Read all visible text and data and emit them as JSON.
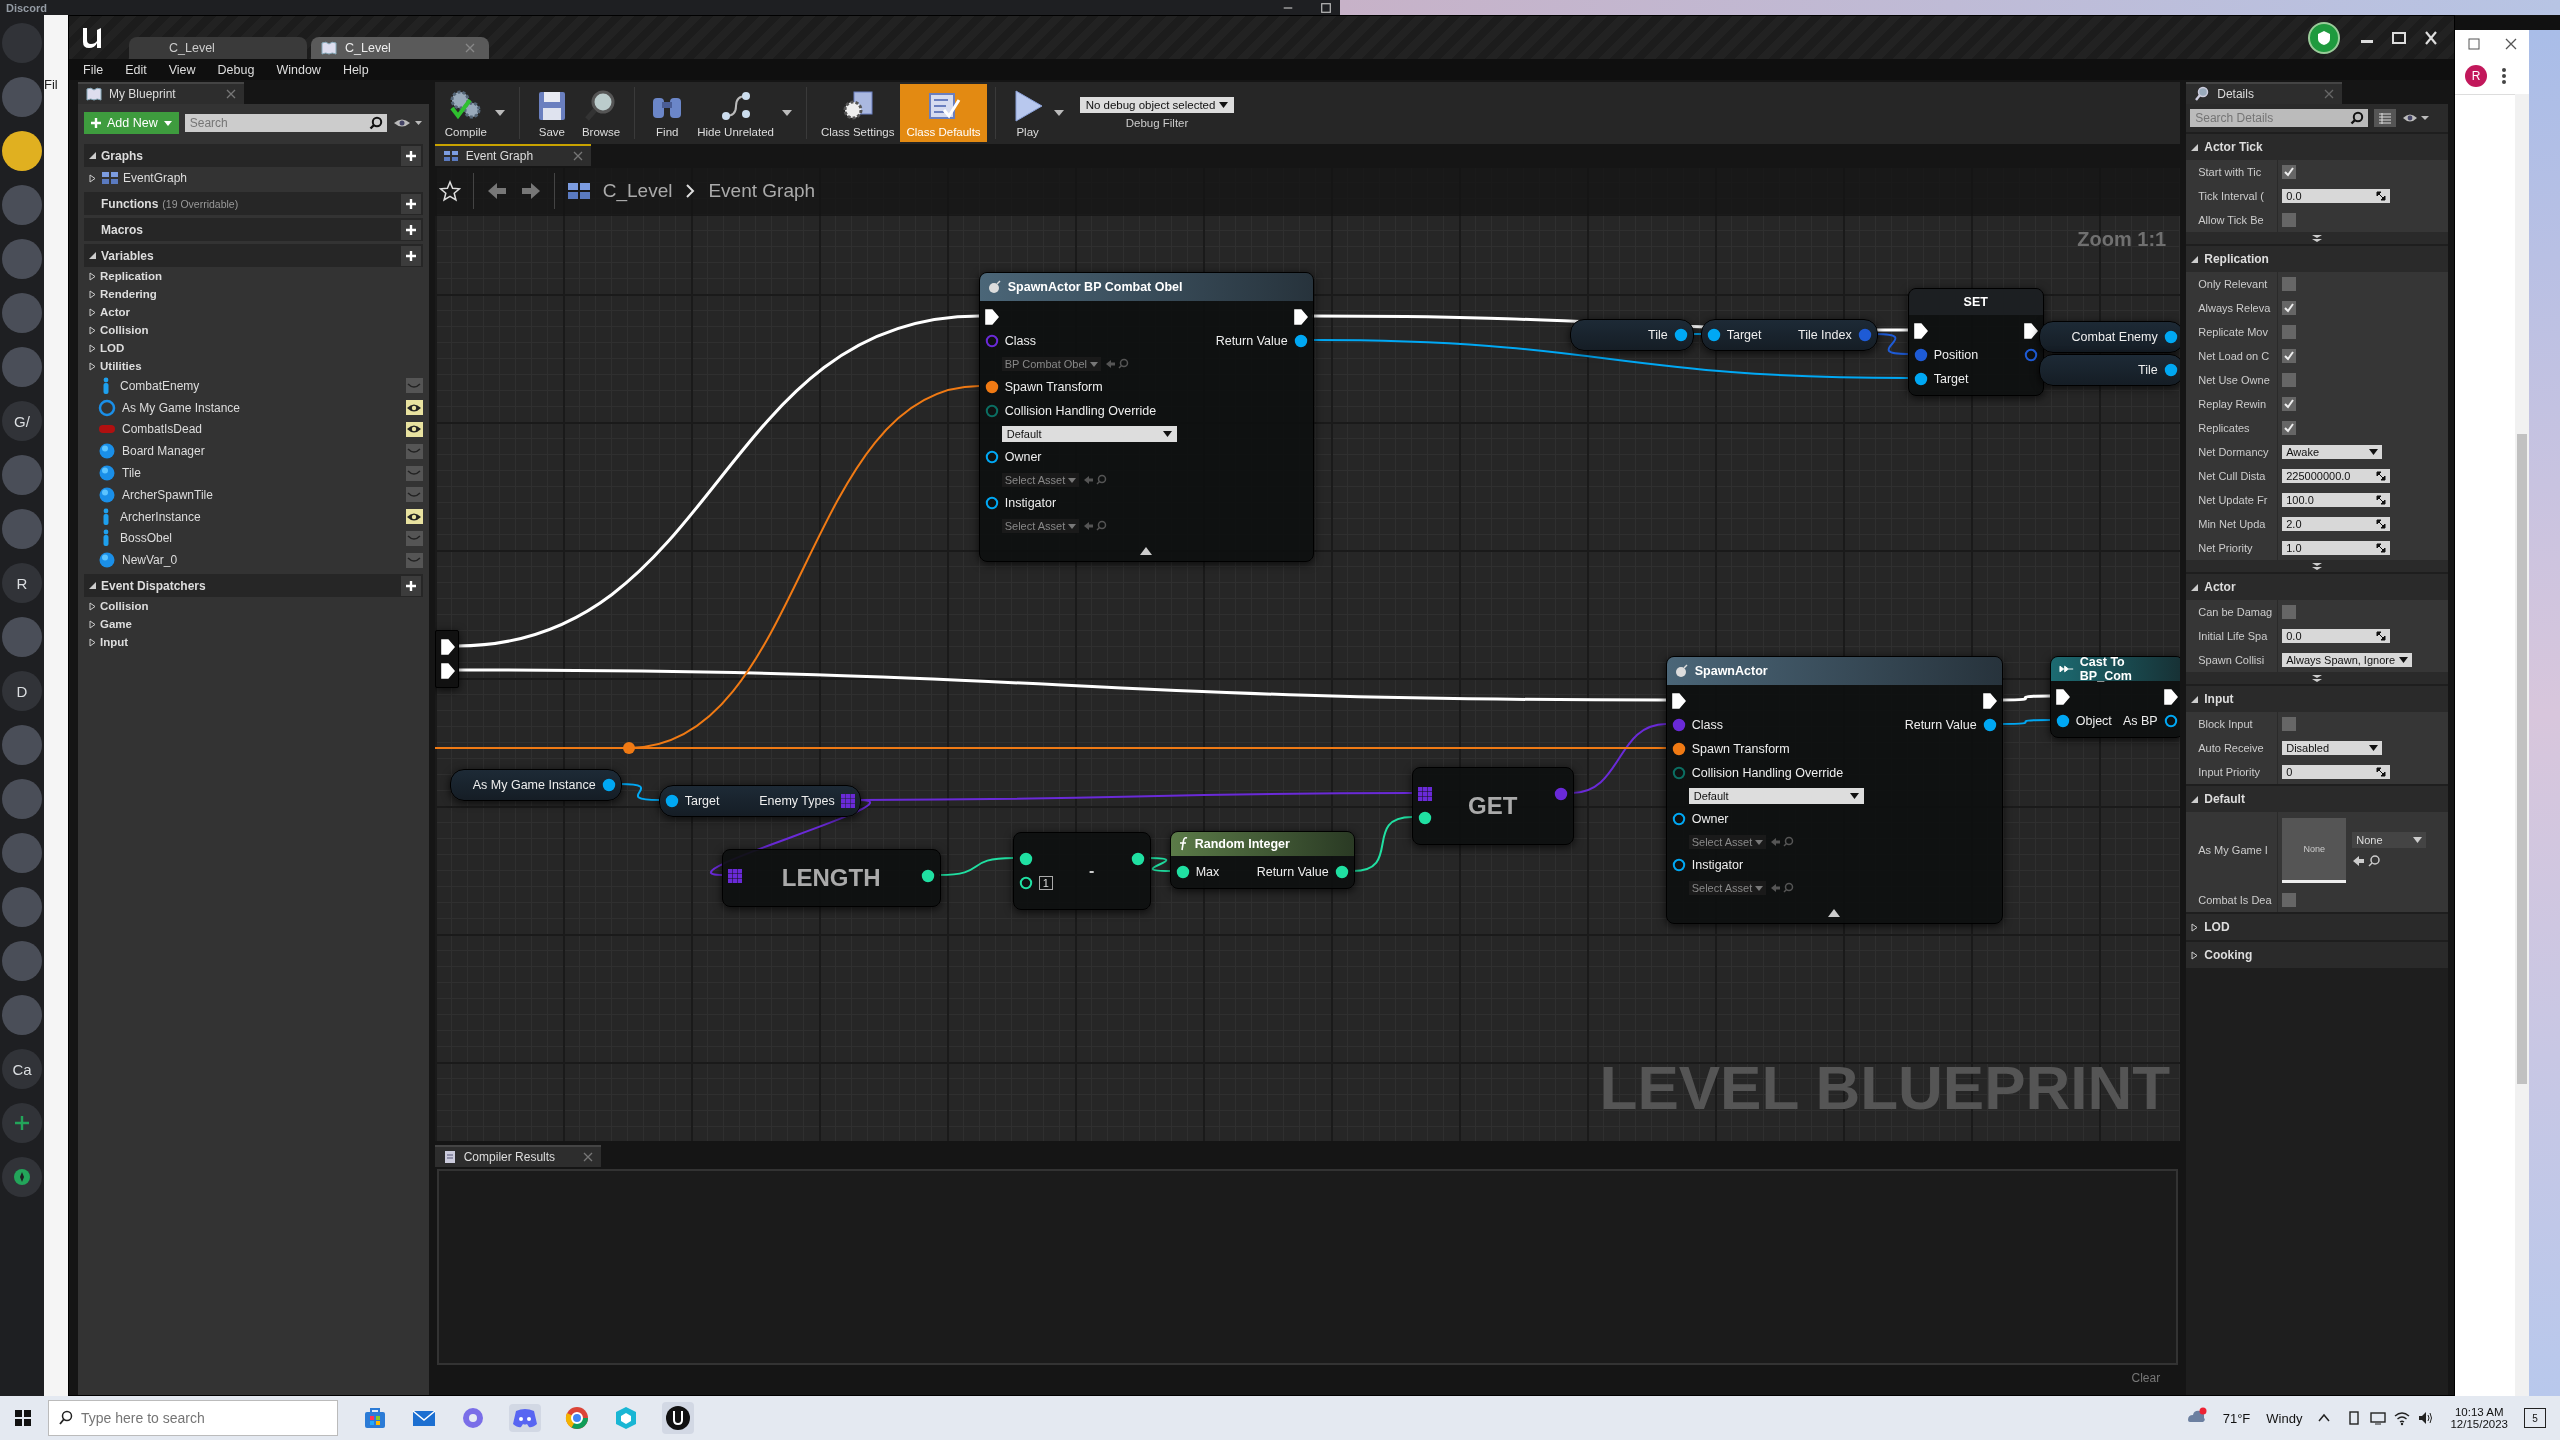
{
  "discord": {
    "title": "Discord",
    "server_labels": [
      "G/",
      "R",
      "D",
      "Ca"
    ],
    "behind_window_label": "Fil"
  },
  "window": {
    "tabs": [
      {
        "label": "C_Level",
        "selected": false
      },
      {
        "label": "C_Level",
        "selected": true
      }
    ],
    "menu": [
      "File",
      "Edit",
      "View",
      "Debug",
      "Window",
      "Help"
    ]
  },
  "my_blueprint": {
    "tab": "My Blueprint",
    "add_button": "Add New",
    "search_placeholder": "Search",
    "sections": [
      {
        "title": "Graphs",
        "expanded": true,
        "items": [
          {
            "label": "EventGraph",
            "kind": "graph"
          }
        ]
      },
      {
        "title": "Functions",
        "note": "(19 Overridable)"
      },
      {
        "title": "Macros"
      },
      {
        "title": "Variables",
        "expanded": true,
        "categories": [
          "Replication",
          "Rendering",
          "Actor",
          "Collision",
          "LOD",
          "Utilities"
        ],
        "items": [
          {
            "label": "CombatEnemy",
            "kind": "actor",
            "exposed": false
          },
          {
            "label": "As My Game Instance",
            "kind": "ring",
            "exposed": true
          },
          {
            "label": "CombatIsDead",
            "kind": "pill",
            "exposed": true
          },
          {
            "label": "Board Manager",
            "kind": "sphere",
            "exposed": false
          },
          {
            "label": "Tile",
            "kind": "sphere",
            "exposed": false
          },
          {
            "label": "ArcherSpawnTile",
            "kind": "sphere",
            "exposed": false
          },
          {
            "label": "ArcherInstance",
            "kind": "actor",
            "exposed": true
          },
          {
            "label": "BossObel",
            "kind": "actor",
            "exposed": false
          },
          {
            "label": "NewVar_0",
            "kind": "sphere",
            "exposed": false
          }
        ]
      },
      {
        "title": "Event Dispatchers",
        "expanded": true,
        "categories": [
          "Collision",
          "Game",
          "Input"
        ]
      }
    ]
  },
  "toolbar": {
    "buttons": [
      {
        "label": "Compile",
        "kind": "compile",
        "dropdown": true,
        "selected": false
      },
      {
        "label": "Save",
        "kind": "save",
        "dropdown": false,
        "selected": false
      },
      {
        "label": "Browse",
        "kind": "browse",
        "dropdown": false,
        "selected": false
      },
      {
        "label": "Find",
        "kind": "find",
        "dropdown": false,
        "selected": false
      },
      {
        "label": "Hide Unrelated",
        "kind": "hide",
        "dropdown": true,
        "selected": false
      },
      {
        "label": "Class Settings",
        "kind": "settings",
        "dropdown": false,
        "selected": false
      },
      {
        "label": "Class Defaults",
        "kind": "defaults",
        "dropdown": false,
        "selected": true
      },
      {
        "label": "Play",
        "kind": "play",
        "dropdown": true,
        "selected": false
      }
    ],
    "debug_value": "No debug object selected",
    "debug_label": "Debug Filter"
  },
  "graph": {
    "tab": "Event Graph",
    "breadcrumb": [
      "C_Level",
      "Event Graph"
    ],
    "zoom": "Zoom 1:1",
    "watermark": "LEVEL BLUEPRINT",
    "nodes": [
      {
        "kind": "spawn",
        "title": "SpawnActor BP Combat Obel",
        "inputs": [
          {
            "kind": "exec",
            "connected": true
          },
          {
            "label": "Class",
            "kind": "class",
            "connected": false,
            "value": "BP Combat Obel"
          },
          {
            "label": "Spawn Transform",
            "kind": "struct",
            "connected": true
          },
          {
            "label": "Collision Handling Override",
            "kind": "enum",
            "connected": false,
            "value": "Default"
          },
          {
            "label": "Owner",
            "kind": "object",
            "connected": false,
            "value": "Select Asset"
          },
          {
            "label": "Instigator",
            "kind": "object",
            "connected": false,
            "value": "Select Asset"
          }
        ],
        "outputs": [
          {
            "kind": "exec",
            "connected": true
          },
          {
            "label": "Return Value",
            "kind": "object",
            "connected": true
          }
        ]
      },
      {
        "kind": "variable",
        "outputs": [
          {
            "label": "Tile",
            "kind": "object",
            "connected": true
          }
        ]
      },
      {
        "kind": "pure",
        "inputs": [
          {
            "label": "Target",
            "kind": "object",
            "connected": true
          }
        ],
        "outputs": [
          {
            "label": "Tile Index",
            "kind": "reference",
            "connected": true
          }
        ]
      },
      {
        "kind": "set",
        "title": "SET",
        "inputs": [
          {
            "kind": "exec",
            "connected": true
          },
          {
            "label": "Position",
            "kind": "reference",
            "connected": true
          },
          {
            "label": "Target",
            "kind": "object",
            "connected": true
          }
        ],
        "outputs": [
          {
            "kind": "exec",
            "connected": true
          },
          {
            "kind": "reference",
            "connected": false
          }
        ]
      },
      {
        "kind": "variable",
        "outputs": [
          {
            "label": "Combat Enemy",
            "kind": "object",
            "connected": true
          }
        ]
      },
      {
        "kind": "variable",
        "outputs": [
          {
            "label": "Tile",
            "kind": "object",
            "connected": true
          }
        ]
      },
      {
        "kind": "reroute",
        "outputs": [
          {
            "kind": "exec",
            "connected": true
          },
          {
            "kind": "exec",
            "connected": true
          }
        ]
      },
      {
        "kind": "variable",
        "outputs": [
          {
            "label": "As My Game Instance",
            "kind": "object",
            "connected": true
          }
        ]
      },
      {
        "kind": "pure",
        "inputs": [
          {
            "label": "Target",
            "kind": "object",
            "connected": true
          }
        ],
        "outputs": [
          {
            "label": "Enemy Types",
            "kind": "array",
            "connected": true
          }
        ]
      },
      {
        "kind": "compact",
        "title": "LENGTH",
        "inputs": [
          {
            "kind": "array",
            "connected": true
          }
        ],
        "outputs": [
          {
            "kind": "int",
            "connected": true
          }
        ]
      },
      {
        "kind": "compact",
        "title": "-",
        "inputs": [
          {
            "kind": "int",
            "connected": true
          },
          {
            "kind": "int",
            "connected": false,
            "value": "1"
          }
        ],
        "outputs": [
          {
            "kind": "int",
            "connected": true
          }
        ]
      },
      {
        "kind": "function",
        "title": "Random Integer",
        "inputs": [
          {
            "label": "Max",
            "kind": "int",
            "connected": true
          }
        ],
        "outputs": [
          {
            "label": "Return Value",
            "kind": "int",
            "connected": true
          }
        ]
      },
      {
        "kind": "compact",
        "title": "GET",
        "inputs": [
          {
            "kind": "array",
            "connected": true
          },
          {
            "kind": "int",
            "connected": true
          }
        ],
        "outputs": [
          {
            "kind": "class",
            "connected": true
          }
        ]
      },
      {
        "kind": "spawn",
        "title": "SpawnActor",
        "inputs": [
          {
            "kind": "exec",
            "connected": true
          },
          {
            "label": "Class",
            "kind": "class",
            "connected": true
          },
          {
            "label": "Spawn Transform",
            "kind": "struct",
            "connected": true
          },
          {
            "label": "Collision Handling Override",
            "kind": "enum",
            "connected": false,
            "value": "Default"
          },
          {
            "label": "Owner",
            "kind": "object",
            "connected": false,
            "value": "Select Asset"
          },
          {
            "label": "Instigator",
            "kind": "object",
            "connected": false,
            "value": "Select Asset"
          }
        ],
        "outputs": [
          {
            "kind": "exec",
            "connected": true
          },
          {
            "label": "Return Value",
            "kind": "object",
            "connected": true
          }
        ]
      },
      {
        "kind": "cast",
        "title": "Cast To BP_Com",
        "inputs": [
          {
            "kind": "exec",
            "connected": true
          },
          {
            "label": "Object",
            "kind": "object",
            "connected": true
          }
        ],
        "outputs": [
          {
            "kind": "exec",
            "connected": true
          },
          {
            "label": "As BP",
            "kind": "object",
            "connected": false
          }
        ]
      }
    ]
  },
  "compiler": {
    "tab": "Compiler Results",
    "clear": "Clear"
  },
  "details": {
    "tab": "Details",
    "search_placeholder": "Search Details",
    "sections": [
      {
        "title": "Actor Tick",
        "expanded": true,
        "advanced": true,
        "rows": [
          {
            "label": "Start with Tic",
            "kind": "checkbox",
            "checked": true
          },
          {
            "label": "Tick Interval (",
            "kind": "number",
            "value": "0.0"
          },
          {
            "label": "Allow Tick Be",
            "kind": "checkbox",
            "checked": false
          }
        ]
      },
      {
        "title": "Replication",
        "expanded": true,
        "advanced": true,
        "rows": [
          {
            "label": "Only Relevant",
            "kind": "checkbox",
            "checked": false
          },
          {
            "label": "Always Releva",
            "kind": "checkbox",
            "checked": true
          },
          {
            "label": "Replicate Mov",
            "kind": "checkbox",
            "checked": false
          },
          {
            "label": "Net Load on C",
            "kind": "checkbox",
            "checked": true
          },
          {
            "label": "Net Use Owne",
            "kind": "checkbox",
            "checked": false
          },
          {
            "label": "Replay Rewin",
            "kind": "checkbox",
            "checked": true
          },
          {
            "label": "Replicates",
            "kind": "checkbox",
            "checked": true
          },
          {
            "label": "Net Dormancy",
            "kind": "dropdown",
            "value": "Awake"
          },
          {
            "label": "Net Cull Dista",
            "kind": "number",
            "value": "225000000.0"
          },
          {
            "label": "Net Update Fr",
            "kind": "number",
            "value": "100.0"
          },
          {
            "label": "Min Net Upda",
            "kind": "number",
            "value": "2.0"
          },
          {
            "label": "Net Priority",
            "kind": "number",
            "value": "1.0"
          }
        ]
      },
      {
        "title": "Actor",
        "expanded": true,
        "advanced": true,
        "rows": [
          {
            "label": "Can be Damag",
            "kind": "checkbox",
            "checked": false
          },
          {
            "label": "Initial Life Spa",
            "kind": "number",
            "value": "0.0"
          },
          {
            "label": "Spawn Collisi",
            "kind": "dropdown",
            "value": "Always Spawn, Ignore"
          }
        ]
      },
      {
        "title": "Input",
        "expanded": true,
        "advanced": false,
        "rows": [
          {
            "label": "Block Input",
            "kind": "checkbox",
            "checked": false
          },
          {
            "label": "Auto Receive",
            "kind": "dropdown",
            "value": "Disabled"
          },
          {
            "label": "Input Priority",
            "kind": "number",
            "value": "0"
          }
        ]
      },
      {
        "title": "Default",
        "expanded": true,
        "advanced": false,
        "rows": [
          {
            "label": "As My Game I",
            "kind": "asset",
            "thumbnail": "None",
            "value": "None"
          },
          {
            "label": "Combat Is Dea",
            "kind": "checkbox",
            "checked": false
          }
        ]
      },
      {
        "title": "LOD",
        "expanded": false
      },
      {
        "title": "Cooking",
        "expanded": false
      }
    ]
  },
  "browser": {
    "avatar": "R"
  },
  "taskbar": {
    "search_placeholder": "Type here to search",
    "temperature": "71°F",
    "weather": "Windy",
    "time": "10:13 AM",
    "date": "12/15/2023",
    "notifications": "5"
  }
}
